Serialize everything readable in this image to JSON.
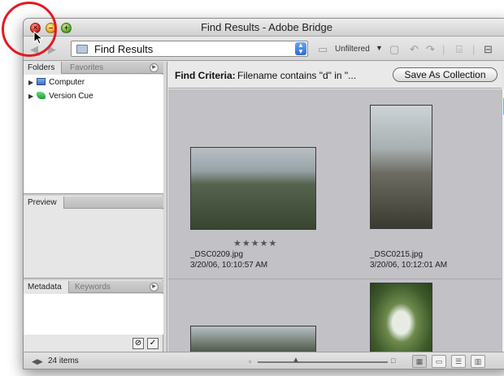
{
  "window": {
    "title": "Find Results - Adobe Bridge"
  },
  "toolbar": {
    "path_label": "Find Results",
    "filter_label": "Unfiltered",
    "back_glyph": "◀",
    "forward_glyph": "▶"
  },
  "left_panel": {
    "tabs_top": [
      "Folders",
      "Favorites"
    ],
    "tree_items": [
      "Computer",
      "Version Cue"
    ],
    "preview_tab": "Preview",
    "tabs_bottom": [
      "Metadata",
      "Keywords"
    ]
  },
  "content": {
    "criteria_label": "Find Criteria:",
    "criteria_text": "Filename contains \"d\" in \"...",
    "save_button": "Save As Collection",
    "thumbs": [
      {
        "filename": "_DSC0209.jpg",
        "date": "3/20/06, 10:10:57 AM",
        "rating": "★★★★★"
      },
      {
        "filename": "_DSC0215.jpg",
        "date": "3/20/06, 10:12:01 AM",
        "rating": ""
      }
    ]
  },
  "status": {
    "count": "24 items"
  },
  "colors": {
    "highlight_ring": "#e01b24",
    "thumb_bg": "#c1c1c6"
  },
  "icons": [
    "close-icon",
    "minimize-icon",
    "zoom-icon",
    "folder-icon",
    "computer-icon",
    "version-cue-icon",
    "cursor-icon"
  ]
}
